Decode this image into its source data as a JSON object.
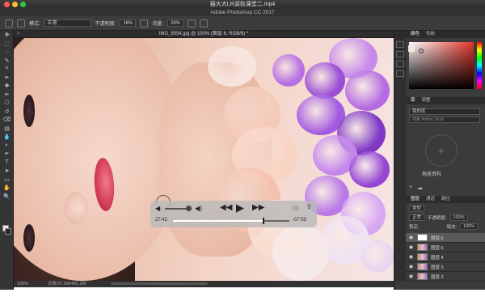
{
  "window": {
    "title": "猫大大LR调色课堂二.mp4",
    "app_title": "Adobe Photoshop CC 2017",
    "traffic_colors": [
      "#fd5f57",
      "#febc2e",
      "#28c840"
    ]
  },
  "options_bar": {
    "mode_label": "模式:",
    "mode_value": "正常",
    "opacity_label": "不透明度:",
    "opacity_value": "16%",
    "flow_label": "流量:",
    "flow_value": "26%"
  },
  "document": {
    "tab_title": "IMG_9554.jpg @ 100% (图层 6, RGB/8) *",
    "close_glyph": "×"
  },
  "video_player": {
    "elapsed": "27:42",
    "remaining": "-07:53",
    "progress": 0.78,
    "volume": 0.85
  },
  "status_bar": {
    "zoom": "100%",
    "doc_size": "文档:67.5M/401.2M"
  },
  "right_panel": {
    "top_tabs": [
      "颜色",
      "色板"
    ],
    "lib_tabs": [
      "库",
      "调整"
    ],
    "lib_select": "我的库",
    "lib_search": "搜索 Adobe Stock",
    "lib_empty_icon": "+",
    "lib_text": "拖放资料",
    "lib_sub": "",
    "layer_tabs": [
      "图层",
      "通道",
      "路径"
    ],
    "layer_kind": "类型",
    "blend_mode": "正常",
    "opacity_label": "不透明度:",
    "opacity_value": "100%",
    "lock_label": "锁定:",
    "fill_label": "填充:",
    "fill_value": "100%",
    "layers": [
      {
        "name": "图层 6",
        "selected": true,
        "white": true
      },
      {
        "name": "图层 5",
        "selected": false,
        "white": false
      },
      {
        "name": "图层 4",
        "selected": false,
        "white": false
      },
      {
        "name": "图层 3",
        "selected": false,
        "white": false
      },
      {
        "name": "图层 2",
        "selected": false,
        "white": false
      }
    ]
  },
  "toolbar": {
    "tools": [
      "move-icon",
      "marquee-icon",
      "lasso-icon",
      "quick-select-icon",
      "crop-icon",
      "eyedropper-icon",
      "healing-icon",
      "brush-icon",
      "stamp-icon",
      "history-brush-icon",
      "eraser-icon",
      "gradient-icon",
      "blur-icon",
      "dodge-icon",
      "pen-icon",
      "type-icon",
      "path-select-icon",
      "shape-icon",
      "hand-icon",
      "zoom-icon"
    ],
    "glyphs": [
      "✥",
      "⬚",
      "◌",
      "✎",
      "⌗",
      "✒",
      "✚",
      "✏",
      "⎔",
      "↺",
      "⌫",
      "▤",
      "💧",
      "◐",
      "✒",
      "T",
      "➤",
      "▭",
      "✋",
      "🔍"
    ]
  }
}
